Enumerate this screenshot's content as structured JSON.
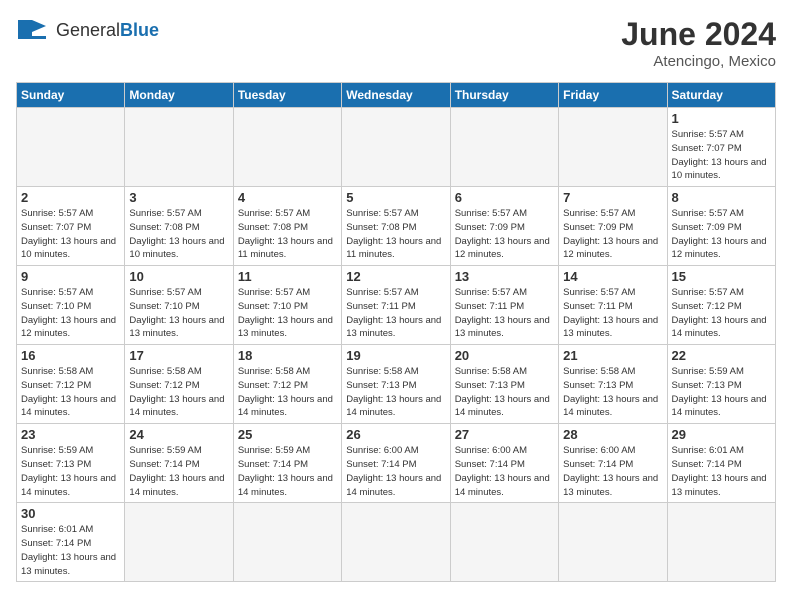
{
  "header": {
    "logo_text_general": "General",
    "logo_text_blue": "Blue",
    "month_title": "June 2024",
    "location": "Atencingo, Mexico"
  },
  "days_of_week": [
    "Sunday",
    "Monday",
    "Tuesday",
    "Wednesday",
    "Thursday",
    "Friday",
    "Saturday"
  ],
  "weeks": [
    [
      {
        "num": "",
        "empty": true
      },
      {
        "num": "",
        "empty": true
      },
      {
        "num": "",
        "empty": true
      },
      {
        "num": "",
        "empty": true
      },
      {
        "num": "",
        "empty": true
      },
      {
        "num": "",
        "empty": true
      },
      {
        "num": "1",
        "sunrise": "5:57 AM",
        "sunset": "7:07 PM",
        "daylight": "13 hours and 10 minutes."
      }
    ],
    [
      {
        "num": "2",
        "sunrise": "5:57 AM",
        "sunset": "7:07 PM",
        "daylight": "13 hours and 10 minutes."
      },
      {
        "num": "3",
        "sunrise": "5:57 AM",
        "sunset": "7:08 PM",
        "daylight": "13 hours and 10 minutes."
      },
      {
        "num": "4",
        "sunrise": "5:57 AM",
        "sunset": "7:08 PM",
        "daylight": "13 hours and 11 minutes."
      },
      {
        "num": "5",
        "sunrise": "5:57 AM",
        "sunset": "7:08 PM",
        "daylight": "13 hours and 11 minutes."
      },
      {
        "num": "6",
        "sunrise": "5:57 AM",
        "sunset": "7:09 PM",
        "daylight": "13 hours and 12 minutes."
      },
      {
        "num": "7",
        "sunrise": "5:57 AM",
        "sunset": "7:09 PM",
        "daylight": "13 hours and 12 minutes."
      },
      {
        "num": "8",
        "sunrise": "5:57 AM",
        "sunset": "7:09 PM",
        "daylight": "13 hours and 12 minutes."
      }
    ],
    [
      {
        "num": "9",
        "sunrise": "5:57 AM",
        "sunset": "7:10 PM",
        "daylight": "13 hours and 12 minutes."
      },
      {
        "num": "10",
        "sunrise": "5:57 AM",
        "sunset": "7:10 PM",
        "daylight": "13 hours and 13 minutes."
      },
      {
        "num": "11",
        "sunrise": "5:57 AM",
        "sunset": "7:10 PM",
        "daylight": "13 hours and 13 minutes."
      },
      {
        "num": "12",
        "sunrise": "5:57 AM",
        "sunset": "7:11 PM",
        "daylight": "13 hours and 13 minutes."
      },
      {
        "num": "13",
        "sunrise": "5:57 AM",
        "sunset": "7:11 PM",
        "daylight": "13 hours and 13 minutes."
      },
      {
        "num": "14",
        "sunrise": "5:57 AM",
        "sunset": "7:11 PM",
        "daylight": "13 hours and 13 minutes."
      },
      {
        "num": "15",
        "sunrise": "5:57 AM",
        "sunset": "7:12 PM",
        "daylight": "13 hours and 14 minutes."
      }
    ],
    [
      {
        "num": "16",
        "sunrise": "5:58 AM",
        "sunset": "7:12 PM",
        "daylight": "13 hours and 14 minutes."
      },
      {
        "num": "17",
        "sunrise": "5:58 AM",
        "sunset": "7:12 PM",
        "daylight": "13 hours and 14 minutes."
      },
      {
        "num": "18",
        "sunrise": "5:58 AM",
        "sunset": "7:12 PM",
        "daylight": "13 hours and 14 minutes."
      },
      {
        "num": "19",
        "sunrise": "5:58 AM",
        "sunset": "7:13 PM",
        "daylight": "13 hours and 14 minutes."
      },
      {
        "num": "20",
        "sunrise": "5:58 AM",
        "sunset": "7:13 PM",
        "daylight": "13 hours and 14 minutes."
      },
      {
        "num": "21",
        "sunrise": "5:58 AM",
        "sunset": "7:13 PM",
        "daylight": "13 hours and 14 minutes."
      },
      {
        "num": "22",
        "sunrise": "5:59 AM",
        "sunset": "7:13 PM",
        "daylight": "13 hours and 14 minutes."
      }
    ],
    [
      {
        "num": "23",
        "sunrise": "5:59 AM",
        "sunset": "7:13 PM",
        "daylight": "13 hours and 14 minutes."
      },
      {
        "num": "24",
        "sunrise": "5:59 AM",
        "sunset": "7:14 PM",
        "daylight": "13 hours and 14 minutes."
      },
      {
        "num": "25",
        "sunrise": "5:59 AM",
        "sunset": "7:14 PM",
        "daylight": "13 hours and 14 minutes."
      },
      {
        "num": "26",
        "sunrise": "6:00 AM",
        "sunset": "7:14 PM",
        "daylight": "13 hours and 14 minutes."
      },
      {
        "num": "27",
        "sunrise": "6:00 AM",
        "sunset": "7:14 PM",
        "daylight": "13 hours and 14 minutes."
      },
      {
        "num": "28",
        "sunrise": "6:00 AM",
        "sunset": "7:14 PM",
        "daylight": "13 hours and 13 minutes."
      },
      {
        "num": "29",
        "sunrise": "6:01 AM",
        "sunset": "7:14 PM",
        "daylight": "13 hours and 13 minutes."
      }
    ],
    [
      {
        "num": "30",
        "sunrise": "6:01 AM",
        "sunset": "7:14 PM",
        "daylight": "13 hours and 13 minutes."
      },
      {
        "num": "",
        "empty": true
      },
      {
        "num": "",
        "empty": true
      },
      {
        "num": "",
        "empty": true
      },
      {
        "num": "",
        "empty": true
      },
      {
        "num": "",
        "empty": true
      },
      {
        "num": "",
        "empty": true
      }
    ]
  ]
}
